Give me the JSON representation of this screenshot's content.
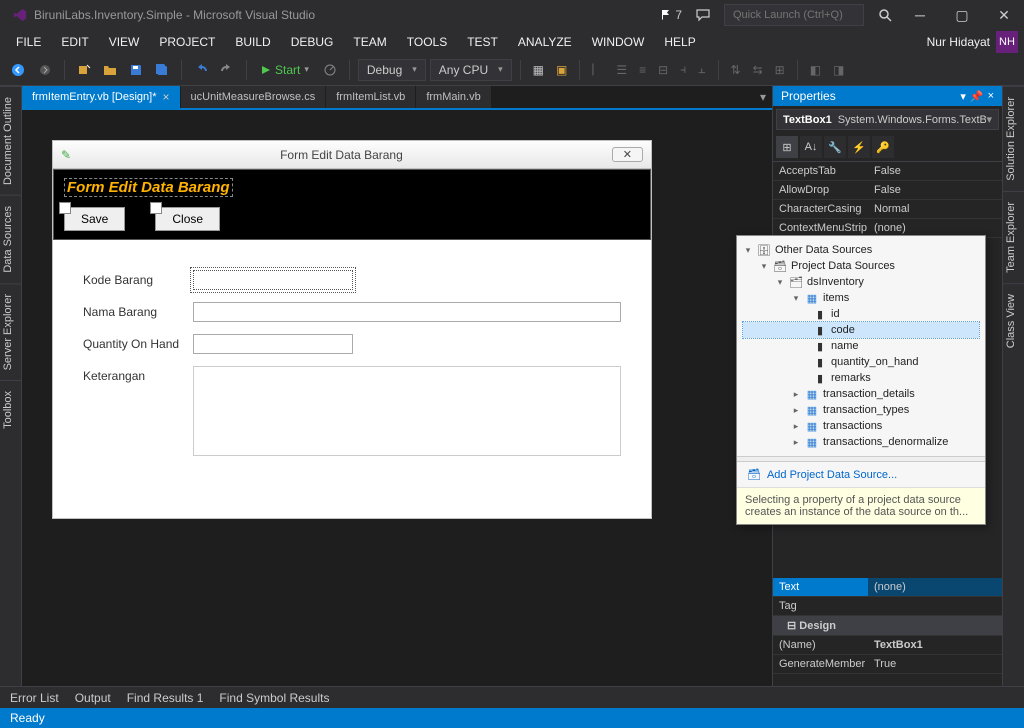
{
  "titlebar": {
    "title": "BiruniLabs.Inventory.Simple - Microsoft Visual Studio",
    "notif_count": "7",
    "quick_launch_placeholder": "Quick Launch (Ctrl+Q)"
  },
  "menubar": {
    "items": [
      "FILE",
      "EDIT",
      "VIEW",
      "PROJECT",
      "BUILD",
      "DEBUG",
      "TEAM",
      "TOOLS",
      "TEST",
      "ANALYZE",
      "WINDOW",
      "HELP"
    ],
    "user": "Nur Hidayat",
    "user_initial": "NH"
  },
  "toolbar": {
    "start_label": "Start",
    "config": "Debug",
    "platform": "Any CPU"
  },
  "tabs": [
    {
      "label": "frmItemEntry.vb [Design]*",
      "active": true,
      "close": true
    },
    {
      "label": "ucUnitMeasureBrowse.cs",
      "active": false,
      "close": false
    },
    {
      "label": "frmItemList.vb",
      "active": false,
      "close": false
    },
    {
      "label": "frmMain.vb",
      "active": false,
      "close": false
    }
  ],
  "left_rail": [
    "Document Outline",
    "Data Sources",
    "Server Explorer",
    "Toolbox"
  ],
  "right_rail": [
    "Solution Explorer",
    "Team Explorer",
    "Class View"
  ],
  "form": {
    "window_title": "Form Edit Data Barang",
    "header_title": "Form Edit Data Barang",
    "save_label": "Save",
    "close_label": "Close",
    "fields": {
      "kode": "Kode Barang",
      "nama": "Nama Barang",
      "qty": "Quantity On Hand",
      "ket": "Keterangan"
    }
  },
  "properties": {
    "panel_title": "Properties",
    "object_name": "TextBox1",
    "object_type": "System.Windows.Forms.TextBox",
    "rows_top": [
      {
        "name": "AcceptsTab",
        "value": "False"
      },
      {
        "name": "AllowDrop",
        "value": "False"
      },
      {
        "name": "CharacterCasing",
        "value": "Normal"
      },
      {
        "name": "ContextMenuStrip",
        "value": "(none)"
      }
    ],
    "rows_bottom": [
      {
        "name": "Text",
        "value": "(none)",
        "selected": true
      },
      {
        "name": "Tag",
        "value": ""
      }
    ],
    "design_group": "Design",
    "design_rows": [
      {
        "name": "(Name)",
        "value": "TextBox1",
        "bold": true
      },
      {
        "name": "GenerateMember",
        "value": "True"
      }
    ]
  },
  "datasource": {
    "root": "Other Data Sources",
    "project": "Project Data Sources",
    "ds": "dsInventory",
    "table": "items",
    "columns": [
      "id",
      "code",
      "name",
      "quantity_on_hand",
      "remarks"
    ],
    "selected_column": "code",
    "other_tables": [
      "transaction_details",
      "transaction_types",
      "transactions",
      "transactions_denormalize"
    ],
    "link": "Add Project Data Source...",
    "description": "Selecting a property of a project data source creates an instance of the data source on th..."
  },
  "bottom_tabs": [
    "Error List",
    "Output",
    "Find Results 1",
    "Find Symbol Results"
  ],
  "status": "Ready"
}
